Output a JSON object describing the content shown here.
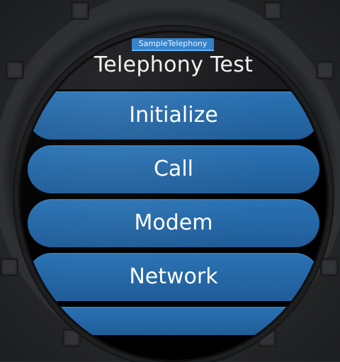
{
  "app": {
    "package_label": "SampleTelephony",
    "title": "Telephony Test"
  },
  "menu": {
    "items": [
      {
        "label": "Initialize"
      },
      {
        "label": "Call"
      },
      {
        "label": "Modem"
      },
      {
        "label": "Network"
      },
      {
        "label": ""
      }
    ]
  },
  "colors": {
    "accent": "#2f7fc9",
    "button": "#2466a4",
    "background": "#000000"
  }
}
